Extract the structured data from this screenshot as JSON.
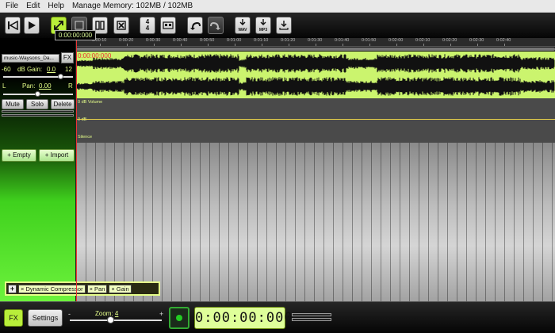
{
  "menu": {
    "file": "File",
    "edit": "Edit",
    "help": "Help",
    "memory": "Manage Memory: 102MB / 102MB"
  },
  "toolbar": {
    "time_sig_top": "4",
    "time_sig_bottom": "4",
    "wav": "WAV",
    "mp3": "MP3",
    "current_time": "0:00:00:000"
  },
  "ruler_ticks": [
    "0:00:10",
    "0:00:20",
    "0:00:30",
    "0:00:40",
    "0:00:50",
    "0:01:00",
    "0:01:10",
    "0:01:20",
    "0:01:30",
    "0:01:40",
    "0:01:50",
    "0:02:00",
    "0:02:10",
    "0:02:20",
    "0:02:30",
    "0:02:40"
  ],
  "track": {
    "name": "music-Waysons_Da...",
    "fx": "FX",
    "gain_min": "-60",
    "gain_label": "dB Gain:",
    "gain_value": "0.0",
    "gain_max": "12",
    "gain_fraction": 0.83,
    "pan_left": "L",
    "pan_label": "Pan:",
    "pan_value": "0.00",
    "pan_right": "R",
    "pan_fraction": 0.5,
    "mute": "Mute",
    "solo": "Solo",
    "delete": "Delete",
    "waveform_time": "0:00:00:000"
  },
  "envelopes": {
    "volume": "0 dB Volume",
    "zero": "0 dB",
    "silence": "Silence"
  },
  "actions": {
    "empty": "+ Empty",
    "import": "+ Import"
  },
  "fx_chain": {
    "add": "+",
    "items": [
      "× Dynamic Compressor",
      "× Pan",
      "× Gain"
    ]
  },
  "bottom": {
    "fx": "FX",
    "settings": "Settings",
    "zoom_minus": "-",
    "zoom_label": "Zoom:",
    "zoom_value": "4",
    "zoom_plus": "+",
    "zoom_fraction": 0.45,
    "clock": "0:00:00:000"
  },
  "colors": {
    "accent": "#dfff9a",
    "waveform_bg": "#cbf46e",
    "playhead": "#e33333",
    "envelope": "#e7d04a"
  }
}
